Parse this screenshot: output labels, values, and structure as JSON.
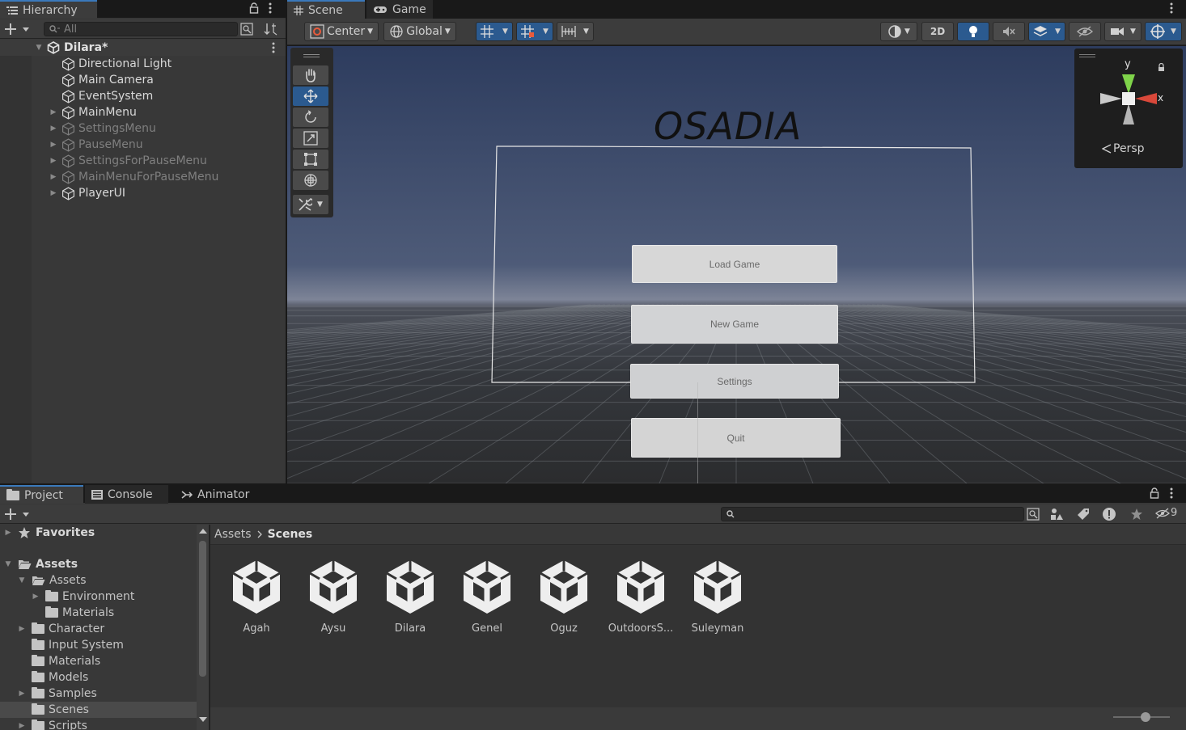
{
  "hierarchy": {
    "tab_label": "Hierarchy",
    "search_placeholder": "All",
    "scene_name": "Dilara*",
    "items": [
      {
        "label": "Directional Light",
        "expandable": false,
        "active": true
      },
      {
        "label": "Main Camera",
        "expandable": false,
        "active": true
      },
      {
        "label": "EventSystem",
        "expandable": false,
        "active": true
      },
      {
        "label": "MainMenu",
        "expandable": true,
        "active": true
      },
      {
        "label": "SettingsMenu",
        "expandable": true,
        "active": false
      },
      {
        "label": "PauseMenu",
        "expandable": true,
        "active": false
      },
      {
        "label": "SettingsForPauseMenu",
        "expandable": true,
        "active": false
      },
      {
        "label": "MainMenuForPauseMenu",
        "expandable": true,
        "active": false
      },
      {
        "label": "PlayerUI",
        "expandable": true,
        "active": true
      }
    ]
  },
  "scene_view": {
    "tabs": [
      {
        "label": "Scene",
        "icon": "grid-icon"
      },
      {
        "label": "Game",
        "icon": "gamepad-icon"
      }
    ],
    "toolbar": {
      "pivot_label": "Center",
      "space_label": "Global",
      "mode_2d_label": "2D"
    },
    "gizmo": {
      "y_label": "y",
      "x_label": "x",
      "projection_label": "Persp"
    },
    "title_text": "OSADIA",
    "menu_buttons": [
      "Load Game",
      "New Game",
      "Settings",
      "Quit"
    ]
  },
  "project": {
    "tabs": [
      {
        "label": "Project",
        "icon": "folder-icon"
      },
      {
        "label": "Console",
        "icon": "console-icon"
      },
      {
        "label": "Animator",
        "icon": "animator-icon"
      }
    ],
    "hidden_count": "9",
    "breadcrumb": [
      "Assets",
      "Scenes"
    ],
    "tree": [
      {
        "label": "Favorites",
        "indent": 0,
        "arrow": "right",
        "icon": "star-icon",
        "bold": true
      },
      {
        "label": "Assets",
        "indent": 0,
        "arrow": "down",
        "icon": "folder-open-icon",
        "bold": true
      },
      {
        "label": "Assets",
        "indent": 1,
        "arrow": "down",
        "icon": "folder-open-icon",
        "bold": false
      },
      {
        "label": "Environment",
        "indent": 2,
        "arrow": "right",
        "icon": "folder-icon",
        "bold": false
      },
      {
        "label": "Materials",
        "indent": 2,
        "arrow": "",
        "icon": "folder-icon",
        "bold": false
      },
      {
        "label": "Character",
        "indent": 1,
        "arrow": "right",
        "icon": "folder-icon",
        "bold": false
      },
      {
        "label": "Input System",
        "indent": 1,
        "arrow": "",
        "icon": "folder-icon",
        "bold": false
      },
      {
        "label": "Materials",
        "indent": 1,
        "arrow": "",
        "icon": "folder-icon",
        "bold": false
      },
      {
        "label": "Models",
        "indent": 1,
        "arrow": "",
        "icon": "folder-icon",
        "bold": false
      },
      {
        "label": "Samples",
        "indent": 1,
        "arrow": "right",
        "icon": "folder-icon",
        "bold": false
      },
      {
        "label": "Scenes",
        "indent": 1,
        "arrow": "",
        "icon": "folder-icon",
        "bold": false,
        "selected": true
      },
      {
        "label": "Scripts",
        "indent": 1,
        "arrow": "right",
        "icon": "folder-icon",
        "bold": false
      }
    ],
    "assets": [
      "Agah",
      "Aysu",
      "Dilara",
      "Genel",
      "Oguz",
      "OutdoorsS...",
      "Suleyman"
    ]
  },
  "colors": {
    "accent": "#3a79bb",
    "panel": "#383838",
    "selected_row": "#2c5d87"
  }
}
